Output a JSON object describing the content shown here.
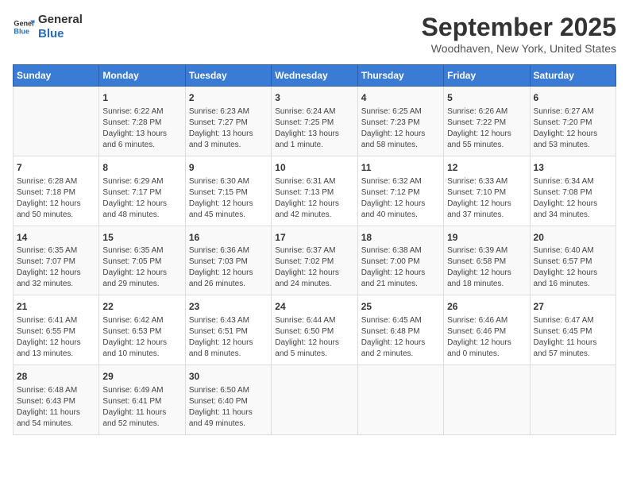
{
  "header": {
    "logo_line1": "General",
    "logo_line2": "Blue",
    "month_title": "September 2025",
    "location": "Woodhaven, New York, United States"
  },
  "weekdays": [
    "Sunday",
    "Monday",
    "Tuesday",
    "Wednesday",
    "Thursday",
    "Friday",
    "Saturday"
  ],
  "weeks": [
    [
      {
        "day": "",
        "info": ""
      },
      {
        "day": "1",
        "info": "Sunrise: 6:22 AM\nSunset: 7:28 PM\nDaylight: 13 hours\nand 6 minutes."
      },
      {
        "day": "2",
        "info": "Sunrise: 6:23 AM\nSunset: 7:27 PM\nDaylight: 13 hours\nand 3 minutes."
      },
      {
        "day": "3",
        "info": "Sunrise: 6:24 AM\nSunset: 7:25 PM\nDaylight: 13 hours\nand 1 minute."
      },
      {
        "day": "4",
        "info": "Sunrise: 6:25 AM\nSunset: 7:23 PM\nDaylight: 12 hours\nand 58 minutes."
      },
      {
        "day": "5",
        "info": "Sunrise: 6:26 AM\nSunset: 7:22 PM\nDaylight: 12 hours\nand 55 minutes."
      },
      {
        "day": "6",
        "info": "Sunrise: 6:27 AM\nSunset: 7:20 PM\nDaylight: 12 hours\nand 53 minutes."
      }
    ],
    [
      {
        "day": "7",
        "info": "Sunrise: 6:28 AM\nSunset: 7:18 PM\nDaylight: 12 hours\nand 50 minutes."
      },
      {
        "day": "8",
        "info": "Sunrise: 6:29 AM\nSunset: 7:17 PM\nDaylight: 12 hours\nand 48 minutes."
      },
      {
        "day": "9",
        "info": "Sunrise: 6:30 AM\nSunset: 7:15 PM\nDaylight: 12 hours\nand 45 minutes."
      },
      {
        "day": "10",
        "info": "Sunrise: 6:31 AM\nSunset: 7:13 PM\nDaylight: 12 hours\nand 42 minutes."
      },
      {
        "day": "11",
        "info": "Sunrise: 6:32 AM\nSunset: 7:12 PM\nDaylight: 12 hours\nand 40 minutes."
      },
      {
        "day": "12",
        "info": "Sunrise: 6:33 AM\nSunset: 7:10 PM\nDaylight: 12 hours\nand 37 minutes."
      },
      {
        "day": "13",
        "info": "Sunrise: 6:34 AM\nSunset: 7:08 PM\nDaylight: 12 hours\nand 34 minutes."
      }
    ],
    [
      {
        "day": "14",
        "info": "Sunrise: 6:35 AM\nSunset: 7:07 PM\nDaylight: 12 hours\nand 32 minutes."
      },
      {
        "day": "15",
        "info": "Sunrise: 6:35 AM\nSunset: 7:05 PM\nDaylight: 12 hours\nand 29 minutes."
      },
      {
        "day": "16",
        "info": "Sunrise: 6:36 AM\nSunset: 7:03 PM\nDaylight: 12 hours\nand 26 minutes."
      },
      {
        "day": "17",
        "info": "Sunrise: 6:37 AM\nSunset: 7:02 PM\nDaylight: 12 hours\nand 24 minutes."
      },
      {
        "day": "18",
        "info": "Sunrise: 6:38 AM\nSunset: 7:00 PM\nDaylight: 12 hours\nand 21 minutes."
      },
      {
        "day": "19",
        "info": "Sunrise: 6:39 AM\nSunset: 6:58 PM\nDaylight: 12 hours\nand 18 minutes."
      },
      {
        "day": "20",
        "info": "Sunrise: 6:40 AM\nSunset: 6:57 PM\nDaylight: 12 hours\nand 16 minutes."
      }
    ],
    [
      {
        "day": "21",
        "info": "Sunrise: 6:41 AM\nSunset: 6:55 PM\nDaylight: 12 hours\nand 13 minutes."
      },
      {
        "day": "22",
        "info": "Sunrise: 6:42 AM\nSunset: 6:53 PM\nDaylight: 12 hours\nand 10 minutes."
      },
      {
        "day": "23",
        "info": "Sunrise: 6:43 AM\nSunset: 6:51 PM\nDaylight: 12 hours\nand 8 minutes."
      },
      {
        "day": "24",
        "info": "Sunrise: 6:44 AM\nSunset: 6:50 PM\nDaylight: 12 hours\nand 5 minutes."
      },
      {
        "day": "25",
        "info": "Sunrise: 6:45 AM\nSunset: 6:48 PM\nDaylight: 12 hours\nand 2 minutes."
      },
      {
        "day": "26",
        "info": "Sunrise: 6:46 AM\nSunset: 6:46 PM\nDaylight: 12 hours\nand 0 minutes."
      },
      {
        "day": "27",
        "info": "Sunrise: 6:47 AM\nSunset: 6:45 PM\nDaylight: 11 hours\nand 57 minutes."
      }
    ],
    [
      {
        "day": "28",
        "info": "Sunrise: 6:48 AM\nSunset: 6:43 PM\nDaylight: 11 hours\nand 54 minutes."
      },
      {
        "day": "29",
        "info": "Sunrise: 6:49 AM\nSunset: 6:41 PM\nDaylight: 11 hours\nand 52 minutes."
      },
      {
        "day": "30",
        "info": "Sunrise: 6:50 AM\nSunset: 6:40 PM\nDaylight: 11 hours\nand 49 minutes."
      },
      {
        "day": "",
        "info": ""
      },
      {
        "day": "",
        "info": ""
      },
      {
        "day": "",
        "info": ""
      },
      {
        "day": "",
        "info": ""
      }
    ]
  ]
}
